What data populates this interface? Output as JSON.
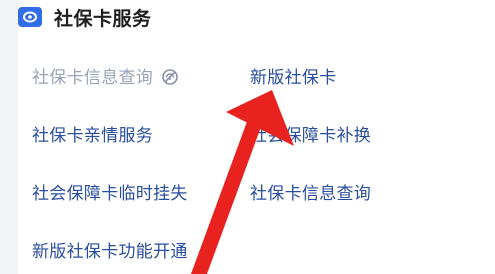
{
  "header": {
    "title": "社保卡服务",
    "icon": "social-security-card-icon",
    "accent_color": "#2f6ee8"
  },
  "services": [
    {
      "label": "社保卡信息查询",
      "status_icon": "offline-icon",
      "disabled": true
    },
    {
      "label": "新版社保卡"
    },
    {
      "label": "社保卡亲情服务"
    },
    {
      "label": "社会保障卡补换"
    },
    {
      "label": "社会保障卡临时挂失"
    },
    {
      "label": "社保卡信息查询"
    },
    {
      "label": "新版社保卡功能开通"
    }
  ],
  "annotation": {
    "icon": "red-arrow-icon",
    "color": "#e8221e"
  }
}
